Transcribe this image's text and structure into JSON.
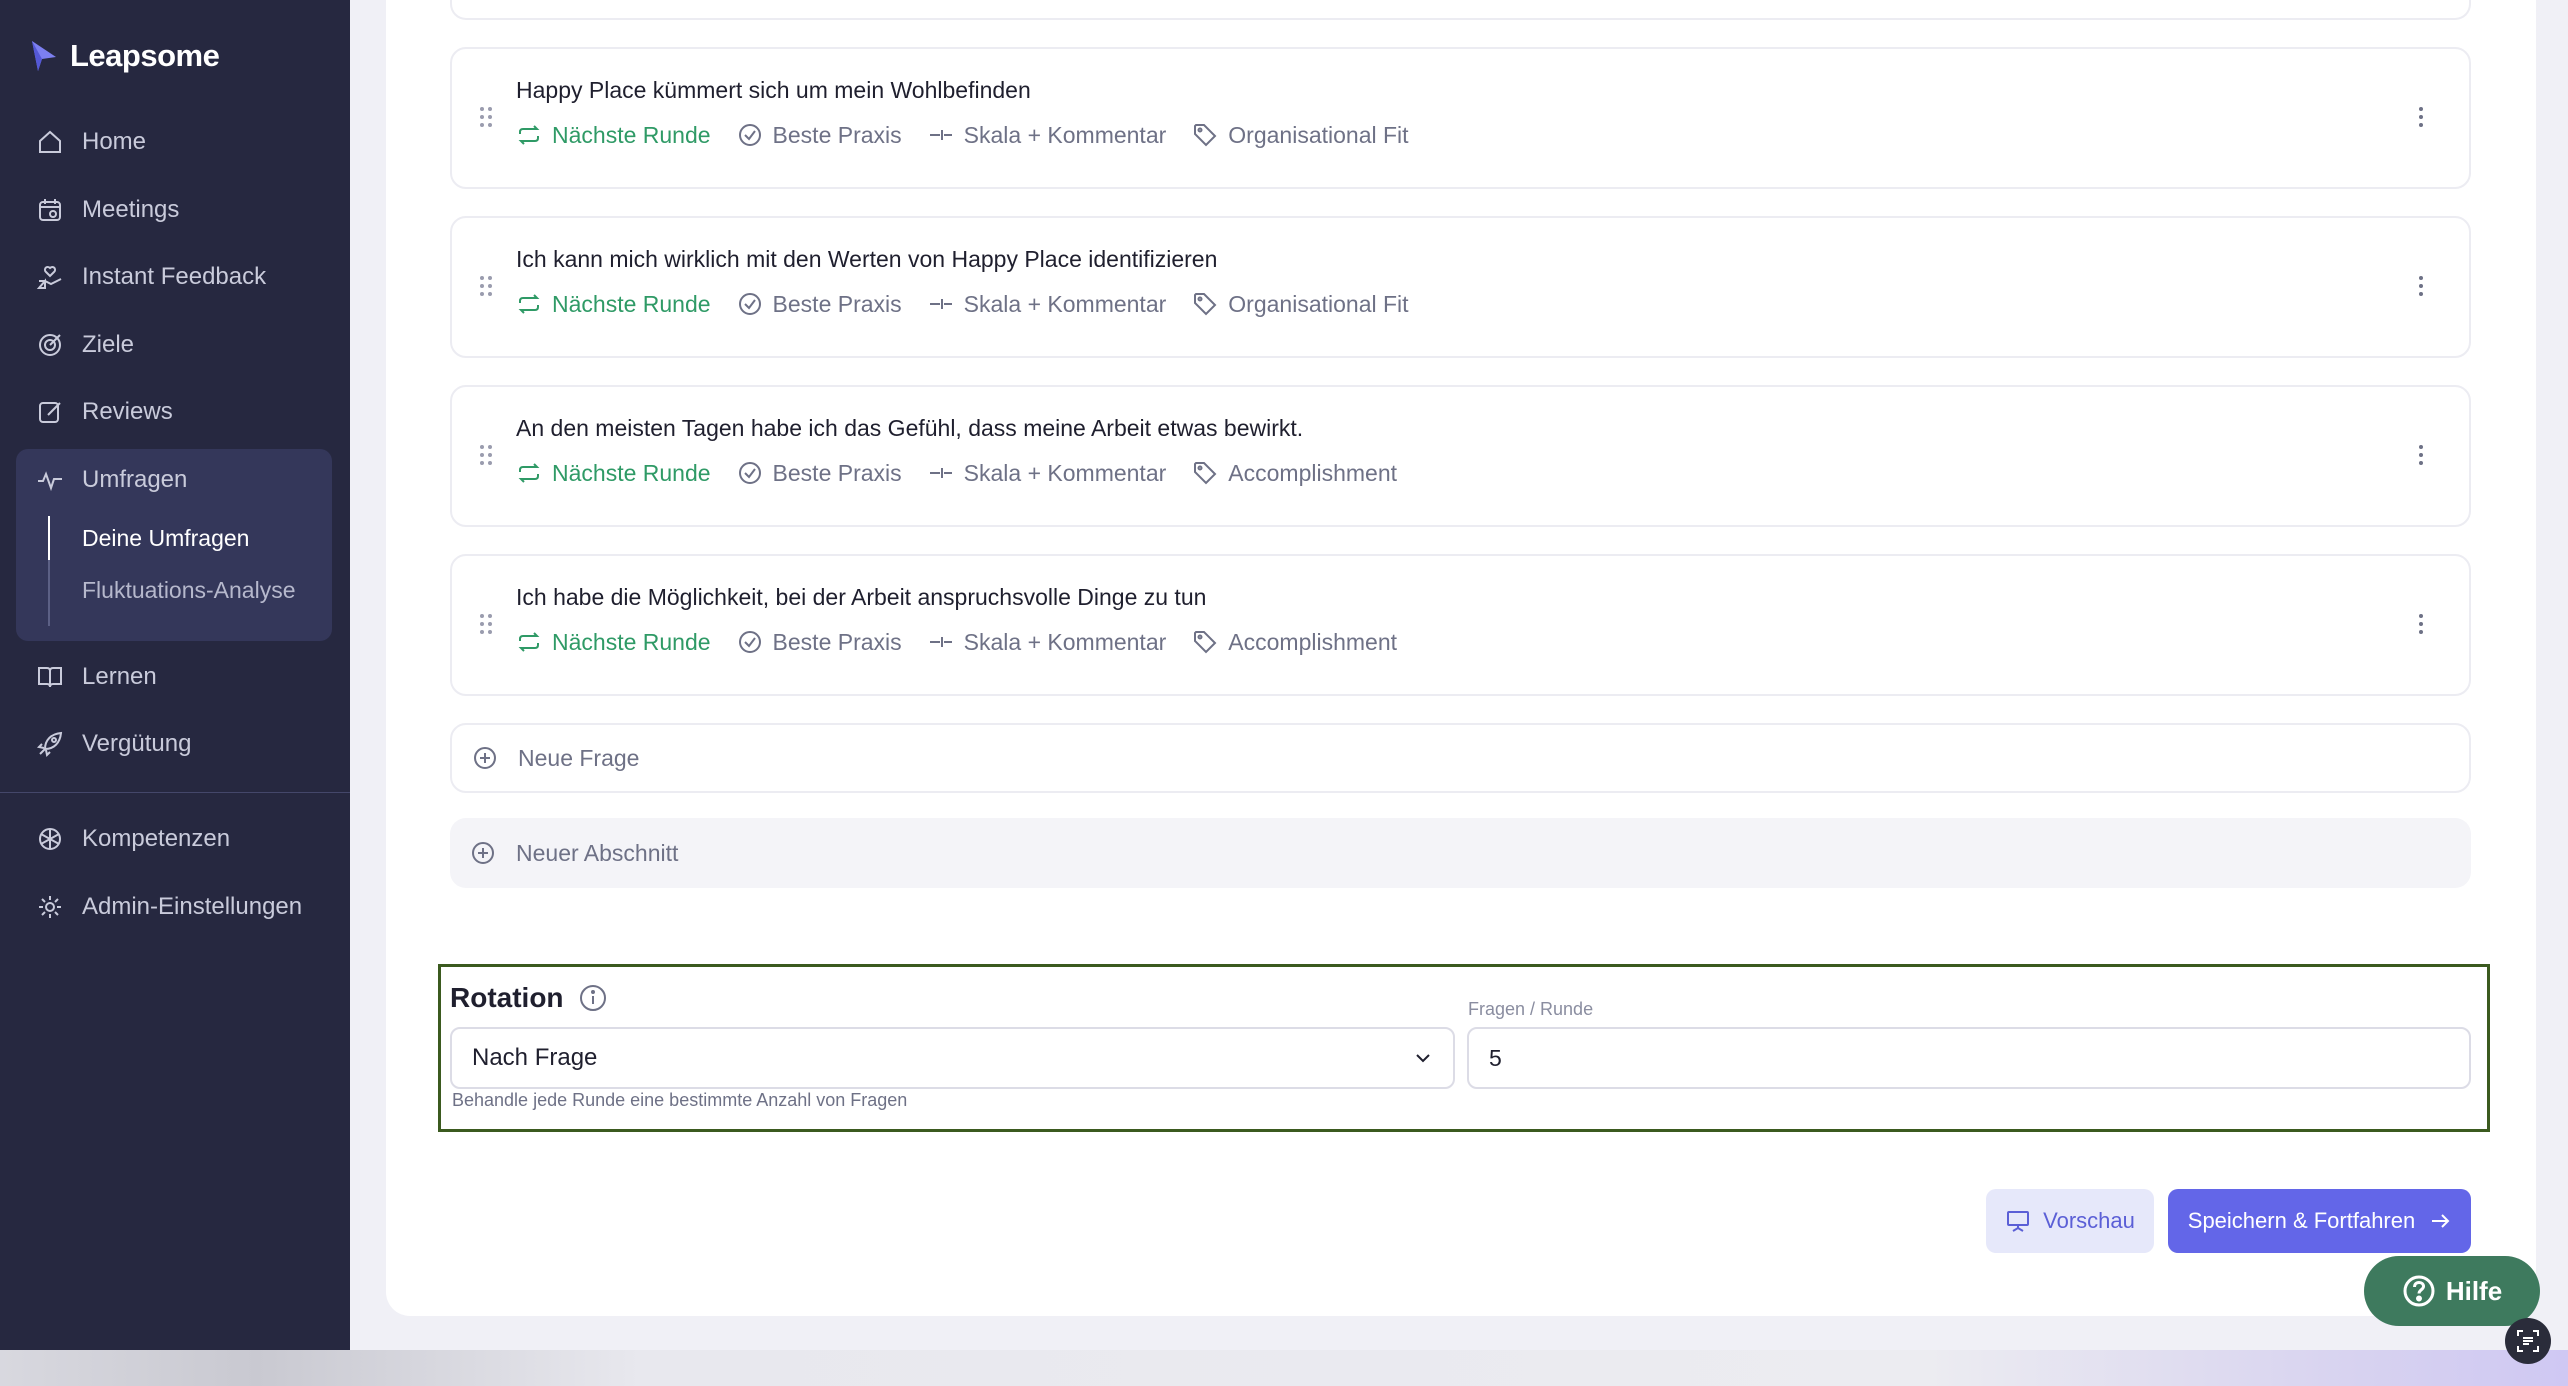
{
  "brand": {
    "name": "Leapsome"
  },
  "nav": {
    "home": "Home",
    "meetings": "Meetings",
    "instant_feedback": "Instant Feedback",
    "ziele": "Ziele",
    "reviews": "Reviews",
    "umfragen": "Umfragen",
    "deine_umfragen": "Deine Umfragen",
    "fluktuation": "Fluktuations-Analyse",
    "lernen": "Lernen",
    "verguetung": "Vergütung",
    "kompetenzen": "Kompetenzen",
    "admin": "Admin-Einstellungen"
  },
  "questions": [
    {
      "title": "Happy Place kümmert sich um mein Wohlbefinden",
      "round": "Nächste Runde",
      "practice": "Beste Praxis",
      "type": "Skala + Kommentar",
      "tag": "Organisational Fit"
    },
    {
      "title": "Ich kann mich wirklich mit den Werten von Happy Place identifizieren",
      "round": "Nächste Runde",
      "practice": "Beste Praxis",
      "type": "Skala + Kommentar",
      "tag": "Organisational Fit"
    },
    {
      "title": "An den meisten Tagen habe ich das Gefühl, dass meine Arbeit etwas bewirkt.",
      "round": "Nächste Runde",
      "practice": "Beste Praxis",
      "type": "Skala + Kommentar",
      "tag": "Accomplishment"
    },
    {
      "title": "Ich habe die Möglichkeit, bei der Arbeit anspruchsvolle Dinge zu tun",
      "round": "Nächste Runde",
      "practice": "Beste Praxis",
      "type": "Skala + Kommentar",
      "tag": "Accomplishment"
    }
  ],
  "actions": {
    "new_question": "Neue Frage",
    "new_section": "Neuer Abschnitt"
  },
  "rotation": {
    "title": "Rotation",
    "mode_value": "Nach Frage",
    "hint": "Behandle jede Runde eine bestimmte Anzahl von Fragen",
    "per_round_label": "Fragen / Runde",
    "per_round_value": "5"
  },
  "buttons": {
    "preview": "Vorschau",
    "save": "Speichern & Fortfahren",
    "help": "Hilfe"
  },
  "colors": {
    "sidebar": "#262840",
    "accent": "#6366e8",
    "green": "#2f9a66",
    "highlight_border": "#3b5a1f"
  }
}
